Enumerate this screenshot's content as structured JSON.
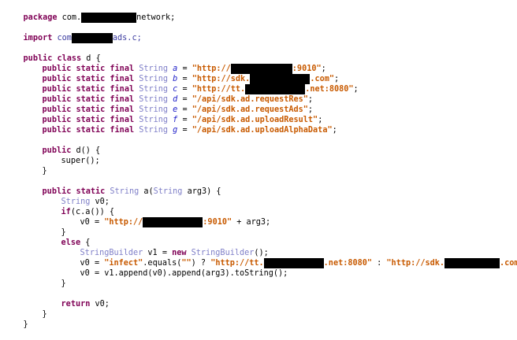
{
  "colors": {
    "background": "#ffffff",
    "keyword": "#7f0055",
    "type": "#7f7fc8",
    "string": "#c85a00",
    "field": "#1e1ec8",
    "redaction": "#000000"
  },
  "code": {
    "l1": {
      "kw": "package",
      "t1": " com.",
      "t2": "network;"
    },
    "l2": {
      "kw": "import",
      "t1": " com",
      "t2": "ads.c;"
    },
    "l3": {
      "kw1": "public",
      "kw2": " class",
      "t1": " d {"
    },
    "fields": [
      {
        "mods": "public static final",
        "type": " String",
        "name": "a",
        "eq": " = ",
        "s1": "\"http://",
        "s2": ":9010\"",
        "end": ";"
      },
      {
        "mods": "public static final",
        "type": " String",
        "name": "b",
        "eq": " = ",
        "s1": "\"http://sdk.",
        "s2": ".com\"",
        "end": ";"
      },
      {
        "mods": "public static final",
        "type": " String",
        "name": "c",
        "eq": " = ",
        "s1": "\"http://tt.",
        "s2": ".net:8080\"",
        "end": ";"
      },
      {
        "mods": "public static final",
        "type": " String",
        "name": "d",
        "eq": " = ",
        "s1": "\"/api/sdk.ad.requestRes\"",
        "end": ";"
      },
      {
        "mods": "public static final",
        "type": " String",
        "name": "e",
        "eq": " = ",
        "s1": "\"/api/sdk.ad.requestAds\"",
        "end": ";"
      },
      {
        "mods": "public static final",
        "type": " String",
        "name": "f",
        "eq": " = ",
        "s1": "\"/api/sdk.ad.uploadResult\"",
        "end": ";"
      },
      {
        "mods": "public static final",
        "type": " String",
        "name": "g",
        "eq": " = ",
        "s1": "\"/api/sdk.ad.uploadAlphaData\"",
        "end": ";"
      }
    ],
    "ctor": {
      "kw": "public",
      "name": " d() {",
      "body": "super();",
      "close": "}"
    },
    "method": {
      "sig_kw": "public static",
      "sig_type": " String",
      "sig_name": " a(",
      "sig_ptype": "String",
      "sig_rest": " arg3) {",
      "decl_type": "String",
      "decl_rest": " v0;",
      "if_kw": "if",
      "if_rest": "(c.a()) {",
      "a1_pre": "v0 = ",
      "a1_s1": "\"http://",
      "a1_s2": ":9010\"",
      "a1_post": " + arg3;",
      "if_close": "}",
      "else_kw": "else",
      "else_rest": " {",
      "sb_type": "StringBuilder",
      "sb_var": " v1 = ",
      "sb_new": "new",
      "sb_ctor": " StringBuilder",
      "sb_end": "();",
      "a2_pre": "v0 = ",
      "a2_s_infect": "\"infect\"",
      "a2_equals": ".equals(",
      "a2_empty": "\"\"",
      "a2_q": ") ? ",
      "a2_s_tt": "\"http://tt.",
      "a2_s_tt2": ".net:8080\"",
      "a2_colon": " : ",
      "a2_s_sdk": "\"http://sdk.",
      "a2_s_sdk2": ".com\"",
      "a2_end": ";",
      "a3": "v0 = v1.append(v0).append(arg3).toString();",
      "else_close": "}",
      "ret_kw": "return",
      "ret_rest": " v0;",
      "m_close": "}"
    },
    "class_close": "}"
  }
}
